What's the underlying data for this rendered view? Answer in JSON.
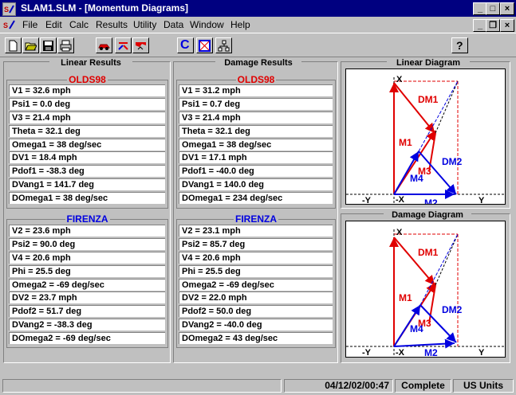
{
  "window": {
    "title": "SLAM1.SLM - [Momentum Diagrams]",
    "controls": {
      "minimize": "_",
      "maximize": "□",
      "close": "×"
    },
    "mdi_controls": {
      "minimize": "_",
      "restore": "❐",
      "close": "×"
    }
  },
  "menu": [
    "File",
    "Edit",
    "Calc",
    "Results",
    "Utility",
    "Data",
    "Window",
    "Help"
  ],
  "toolbar": {
    "buttons": [
      "new",
      "open",
      "save",
      "print",
      "car",
      "impact",
      "damage",
      "calc",
      "crush",
      "tree",
      "help"
    ],
    "calc_label": "C",
    "help_label": "?"
  },
  "linear": {
    "title": "Linear Results",
    "v1_header": "OLDS98",
    "v1_group1": [
      "V1 = 32.6 mph",
      "Psi1 = 0.0 deg",
      "V3 = 21.4 mph",
      "Theta = 32.1 deg",
      "Omega1 = 38 deg/sec"
    ],
    "v1_group2": [
      "DV1 = 18.4 mph",
      "Pdof1 = -38.3 deg",
      "DVang1 = 141.7 deg",
      "DOmega1 = 38 deg/sec"
    ],
    "v2_header": "FIRENZA",
    "v2_group1": [
      "V2 = 23.6 mph",
      "Psi2 = 90.0 deg",
      "V4 = 20.6 mph",
      "Phi = 25.5 deg",
      "Omega2 = -69 deg/sec"
    ],
    "v2_group2": [
      "DV2 = 23.7 mph",
      "Pdof2 = 51.7 deg",
      "DVang2 = -38.3 deg",
      "DOmega2 = -69 deg/sec"
    ]
  },
  "damage": {
    "title": "Damage Results",
    "v1_header": "OLDS98",
    "v1_group1": [
      "V1 = 31.2 mph",
      "Psi1 = 0.7 deg",
      "V3 = 21.4 mph",
      "Theta = 32.1 deg",
      "Omega1 = 38 deg/sec"
    ],
    "v1_group2": [
      "DV1 = 17.1 mph",
      "Pdof1 = -40.0 deg",
      "DVang1 = 140.0 deg",
      "DOmega1 = 234 deg/sec"
    ],
    "v2_header": "FIRENZA",
    "v2_group1": [
      "V2 = 23.1 mph",
      "Psi2 = 85.7 deg",
      "V4 = 20.6 mph",
      "Phi = 25.5 deg",
      "Omega2 = -69 deg/sec"
    ],
    "v2_group2": [
      "DV2 = 22.0 mph",
      "Pdof2 = 50.0 deg",
      "DVang2 = -40.0 deg",
      "DOmega2 = 43 deg/sec"
    ]
  },
  "linear_diagram": {
    "title": "Linear Diagram",
    "labels": {
      "x_top": "X",
      "x_bot": "-X",
      "y_left": "-Y",
      "y_right": "Y",
      "dm1": "DM1",
      "dm2": "DM2",
      "m1": "M1",
      "m2": "M2",
      "m3": "M3",
      "m4": "M4"
    }
  },
  "damage_diagram": {
    "title": "Damage Diagram",
    "labels": {
      "x_top": "X",
      "x_bot": "-X",
      "y_left": "-Y",
      "y_right": "Y",
      "dm1": "DM1",
      "dm2": "DM2",
      "m1": "M1",
      "m2": "M2",
      "m3": "M3",
      "m4": "M4"
    }
  },
  "colors": {
    "v1": "#e00000",
    "v2": "#0000e0",
    "title_bar": "#000080"
  },
  "status": {
    "date": "04/12/02/00:47",
    "state": "Complete",
    "units": "US Units"
  }
}
